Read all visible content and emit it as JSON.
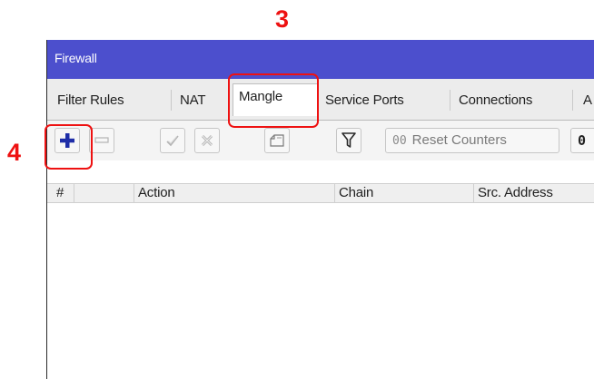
{
  "annotations": {
    "step3": "3",
    "step4": "4",
    "highlight_color": "#ee1111"
  },
  "window": {
    "title": "Firewall",
    "title_bar_color": "#4c4fcd"
  },
  "tabs": [
    {
      "label": "Filter Rules",
      "active": false
    },
    {
      "label": "NAT",
      "active": false
    },
    {
      "label": "Mangle",
      "active": true
    },
    {
      "label": "Service Ports",
      "active": false
    },
    {
      "label": "Connections",
      "active": false
    },
    {
      "label": "A",
      "active": false
    }
  ],
  "toolbar": {
    "add_icon": "plus-icon",
    "remove_icon": "minus-icon",
    "enable_icon": "check-icon",
    "disable_icon": "cross-icon",
    "comment_icon": "comment-icon",
    "filter_icon": "filter-icon",
    "reset_counters_prefix": "00",
    "reset_counters_label": "Reset Counters",
    "cut_button_label": "0"
  },
  "table": {
    "columns": [
      "#",
      "",
      "Action",
      "Chain",
      "Src. Address"
    ],
    "rows": []
  }
}
